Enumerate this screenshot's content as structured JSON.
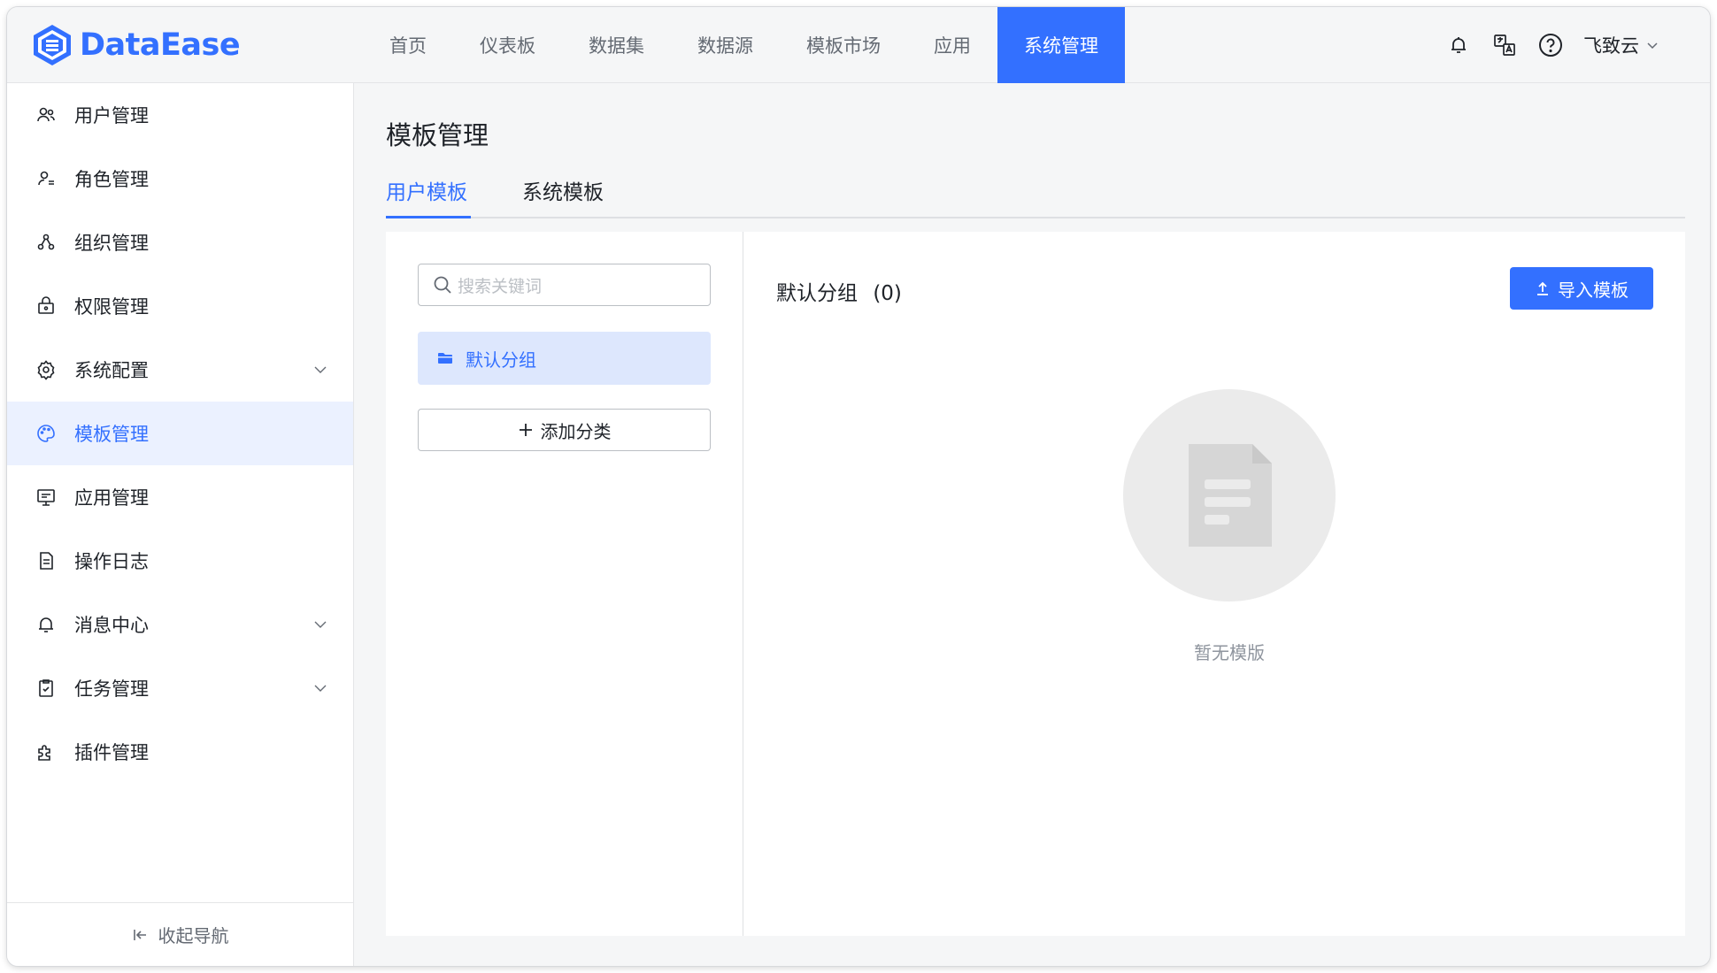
{
  "app": {
    "logo_text": "DataEase",
    "brand_color": "#3370ff"
  },
  "topnav": {
    "items": [
      {
        "label": "首页"
      },
      {
        "label": "仪表板"
      },
      {
        "label": "数据集"
      },
      {
        "label": "数据源"
      },
      {
        "label": "模板市场"
      },
      {
        "label": "应用"
      },
      {
        "label": "系统管理",
        "active": true
      }
    ],
    "icons": [
      "bell-icon",
      "translate-icon",
      "help-icon"
    ],
    "user_name": "飞致云"
  },
  "sidebar": {
    "items": [
      {
        "label": "用户管理",
        "icon": "users-icon"
      },
      {
        "label": "角色管理",
        "icon": "role-icon"
      },
      {
        "label": "组织管理",
        "icon": "org-icon"
      },
      {
        "label": "权限管理",
        "icon": "lock-icon"
      },
      {
        "label": "系统配置",
        "icon": "gear-icon",
        "expandable": true
      },
      {
        "label": "模板管理",
        "icon": "palette-icon",
        "active": true
      },
      {
        "label": "应用管理",
        "icon": "app-icon"
      },
      {
        "label": "操作日志",
        "icon": "log-icon"
      },
      {
        "label": "消息中心",
        "icon": "bell-icon",
        "expandable": true
      },
      {
        "label": "任务管理",
        "icon": "task-icon",
        "expandable": true
      },
      {
        "label": "插件管理",
        "icon": "plugin-icon"
      }
    ],
    "collapse_label": "收起导航"
  },
  "main": {
    "title": "模板管理",
    "tabs": [
      {
        "label": "用户模板",
        "active": true
      },
      {
        "label": "系统模板"
      }
    ],
    "search": {
      "placeholder": "搜索关键词"
    },
    "groups": [
      {
        "label": "默认分组",
        "selected": true
      }
    ],
    "add_category_label": "添加分类",
    "current_group": {
      "name": "默认分组",
      "count": "(0)"
    },
    "import_label": "导入模板",
    "empty_text": "暂无模版"
  }
}
